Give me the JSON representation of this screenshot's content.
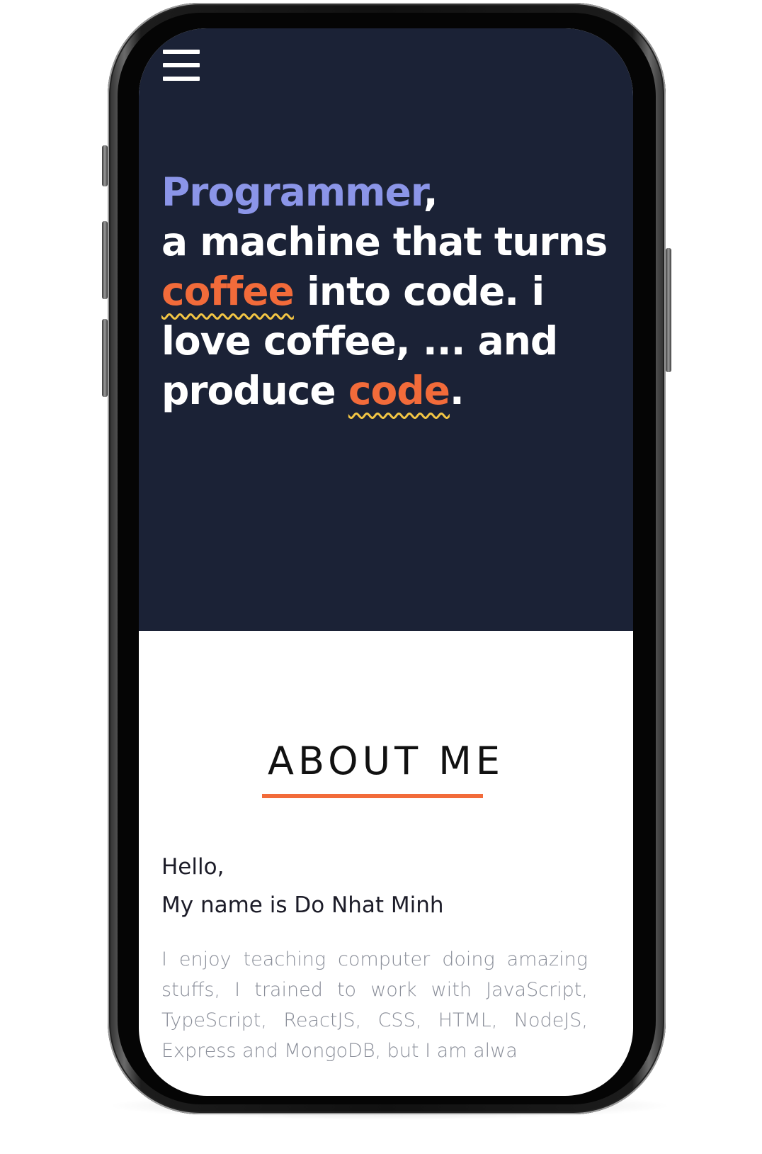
{
  "hero": {
    "line1_highlight": "Programmer",
    "line1_suffix": ",",
    "line2": "a machine that turns",
    "coffee": "coffee",
    "line3_suffix": " into code. i love coffee, ... and produce ",
    "code": "code",
    "end_punct": ".",
    "colors": {
      "background": "#1b2236",
      "blue_highlight": "#8b95e8",
      "orange_highlight": "#f26b3a",
      "wavy_underline": "#f2c544"
    }
  },
  "menu": {
    "icon": "hamburger-menu-icon"
  },
  "about": {
    "title": "ABOUT ME",
    "greeting_line1": "Hello,",
    "greeting_line2": "My name is Do Nhat Minh",
    "bio": "I enjoy teaching computer doing amazing stuffs, I trained to work with JavaScript, TypeScript, ReactJS, CSS, HTML, NodeJS, Express and MongoDB, but I am alwa",
    "accent_color": "#f26b3a"
  }
}
